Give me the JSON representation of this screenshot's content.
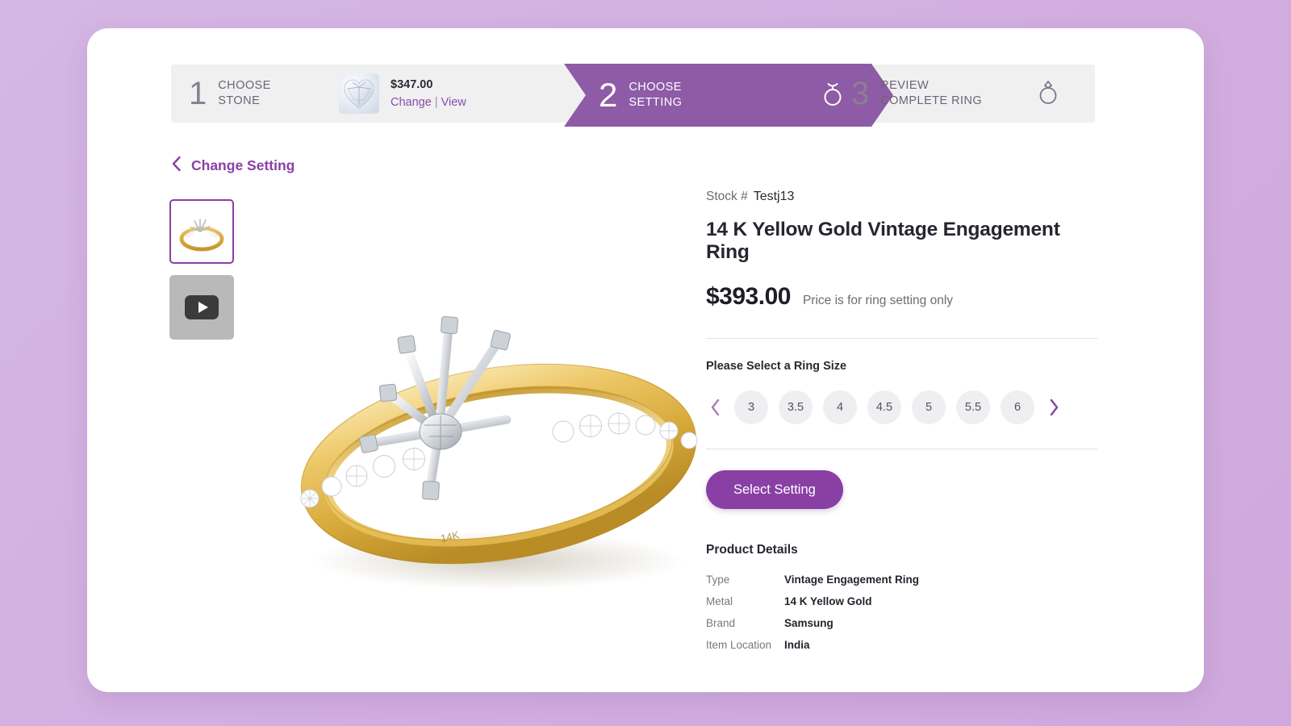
{
  "theme": {
    "page_bg": "#d3b2e2",
    "accent_purple": "#8a3fa5",
    "step_active_purple": "#8e5ba6",
    "card_bg": "#ffffff",
    "step_track_bg": "#f0f0f1"
  },
  "steps": {
    "step1": {
      "number": "1",
      "line1": "CHOOSE",
      "line2": "STONE",
      "stone": {
        "price": "$347.00",
        "change_label": "Change",
        "separator": "|",
        "view_label": "View",
        "thumb_icon": "diamond-stone-icon"
      }
    },
    "step2": {
      "number": "2",
      "line1": "CHOOSE",
      "line2": "SETTING",
      "icon": "ring-setting-icon",
      "active": true
    },
    "step3": {
      "number": "3",
      "line1": "REVIEW",
      "line2": "COMPLETE RING",
      "icon": "diamond-ring-icon"
    }
  },
  "back_link": {
    "icon": "chevron-left-icon",
    "label": "Change Setting"
  },
  "gallery": {
    "thumbnails": [
      {
        "name": "ring-image-thumbnail",
        "type": "image",
        "selected": true
      },
      {
        "name": "ring-video-thumbnail",
        "type": "video",
        "icon": "play-button-icon",
        "selected": false
      }
    ],
    "hero_alt": "14 K Yellow Gold Vintage Engagement Ring setting"
  },
  "product": {
    "stock_label": "Stock #",
    "stock_value": "Testj13",
    "title": "14 K Yellow Gold Vintage Engagement Ring",
    "price": "$393.00",
    "price_note": "Price is for ring setting only"
  },
  "ring_size": {
    "section_title": "Please Select a Ring Size",
    "prev_icon": "chevron-left-icon",
    "next_icon": "chevron-right-icon",
    "options": [
      "3",
      "3.5",
      "4",
      "4.5",
      "5",
      "5.5",
      "6"
    ],
    "selected": null
  },
  "cta": {
    "select_setting_label": "Select Setting"
  },
  "product_details": {
    "title": "Product Details",
    "rows": [
      {
        "key": "Type",
        "value": "Vintage Engagement Ring"
      },
      {
        "key": "Metal",
        "value": "14 K Yellow Gold"
      },
      {
        "key": "Brand",
        "value": "Samsung"
      },
      {
        "key": "Item Location",
        "value": "India"
      }
    ]
  }
}
